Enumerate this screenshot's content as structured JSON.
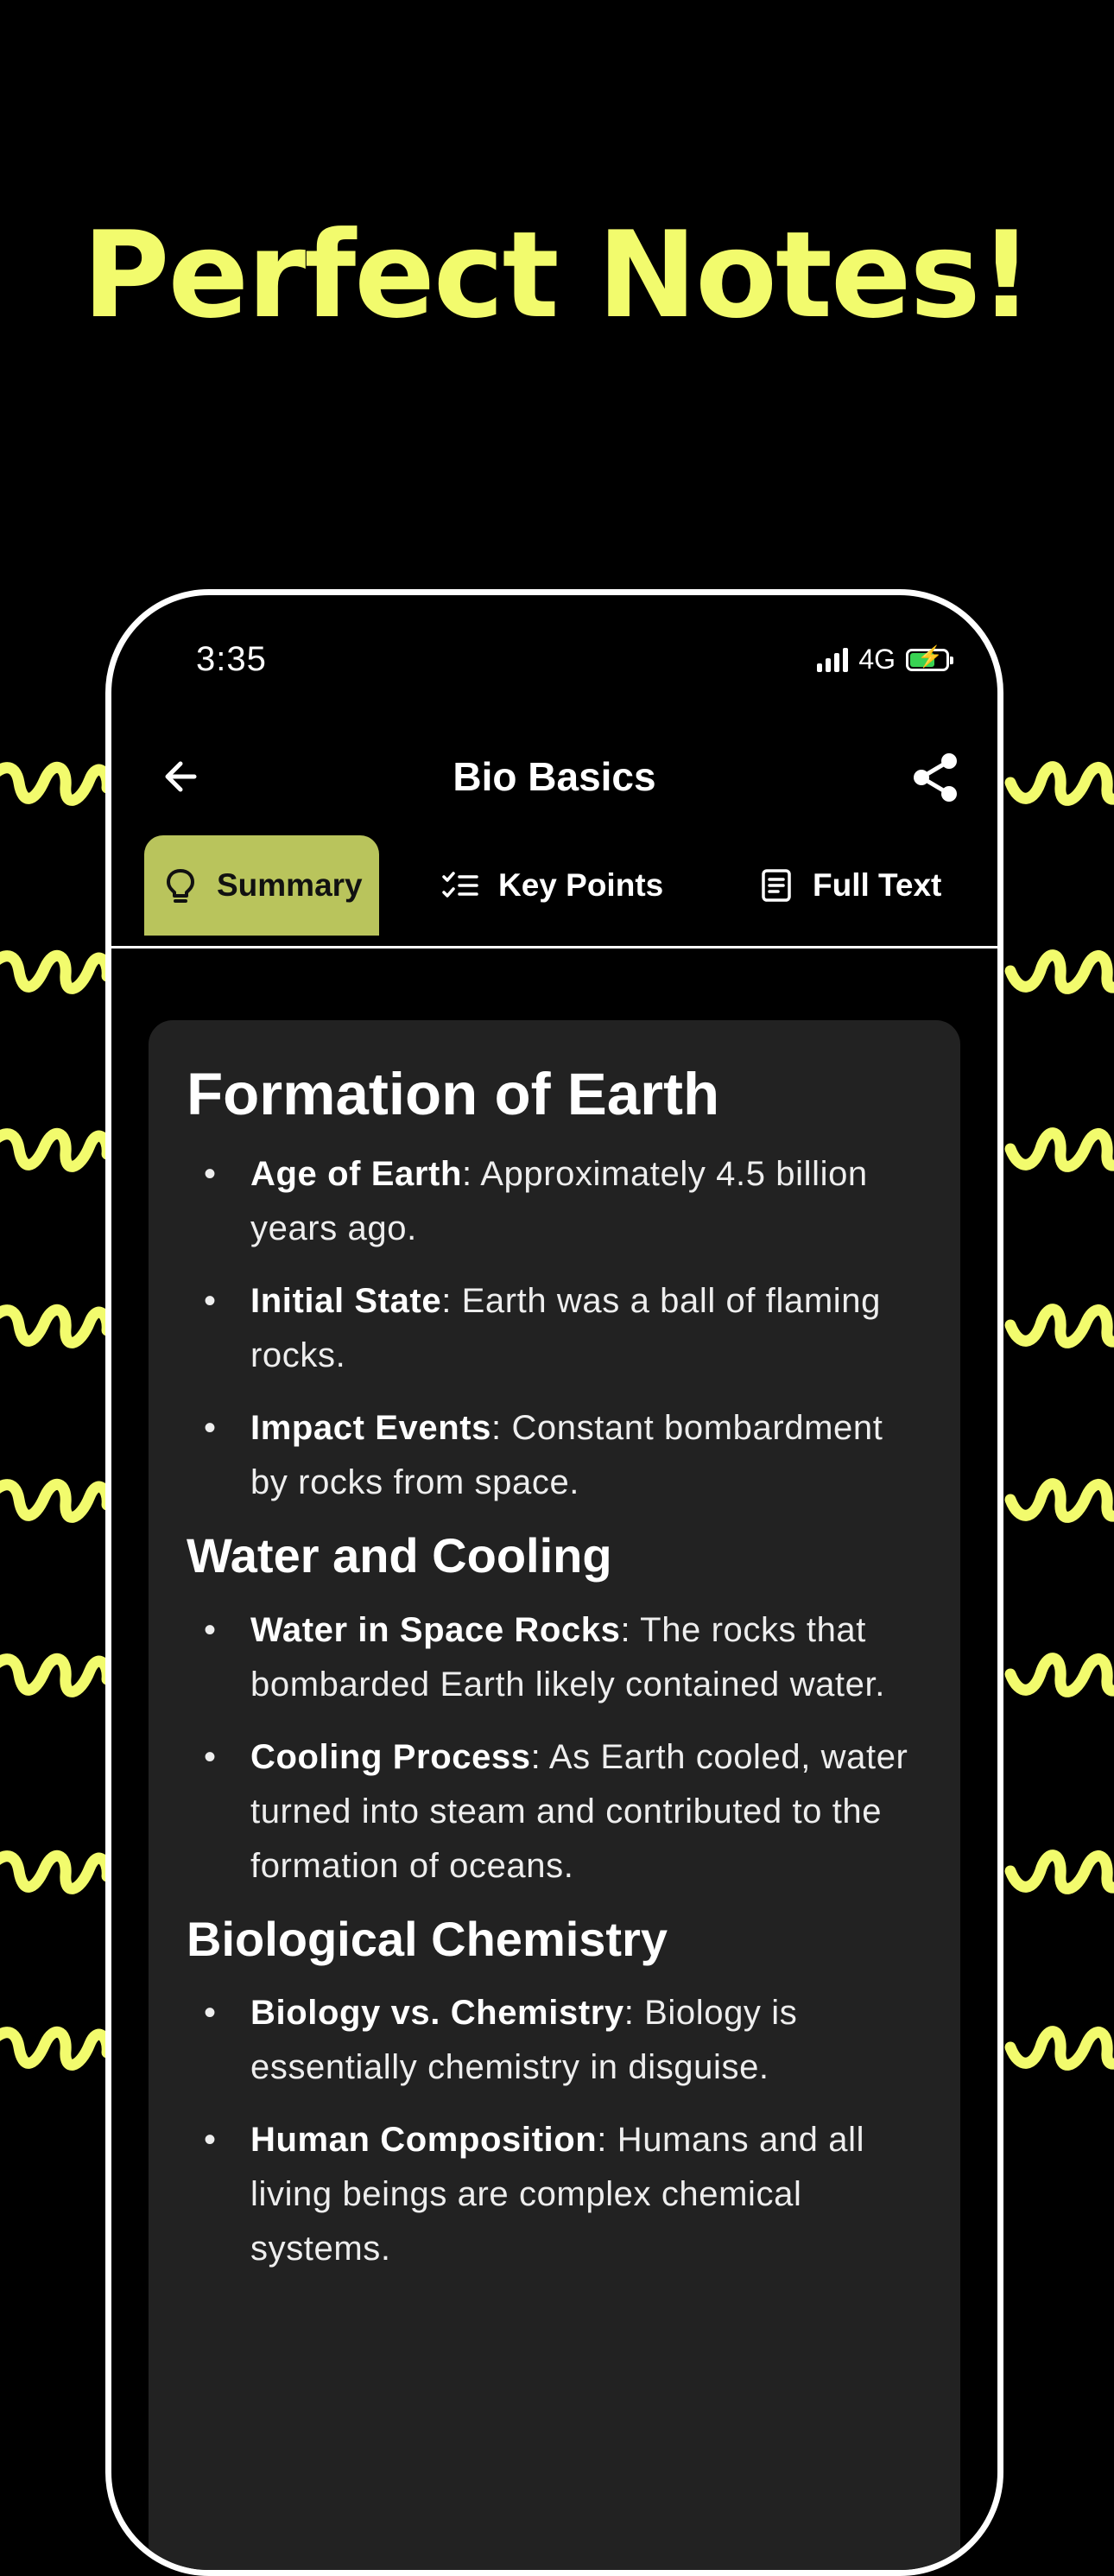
{
  "headline": "Perfect Notes!",
  "colors": {
    "accent": "#f2fb6d",
    "tab_active_bg": "#b9c45c",
    "card_bg": "#222222",
    "battery_fill": "#39d353"
  },
  "status_bar": {
    "time": "3:35",
    "network": "4G"
  },
  "nav": {
    "title": "Bio Basics",
    "back_icon": "arrow-left-icon",
    "share_icon": "share-icon"
  },
  "tabs": [
    {
      "label": "Summary",
      "icon": "lightbulb-icon",
      "active": true
    },
    {
      "label": "Key Points",
      "icon": "checklist-icon",
      "active": false
    },
    {
      "label": "Full Text",
      "icon": "document-icon",
      "active": false
    }
  ],
  "sections": [
    {
      "heading": "Formation of Earth",
      "items": [
        {
          "term": "Age of Earth",
          "text": ": Approximately 4.5 billion years ago."
        },
        {
          "term": "Initial State",
          "text": ": Earth was a ball of flaming rocks."
        },
        {
          "term": "Impact Events",
          "text": ": Constant bombardment by rocks from space."
        }
      ]
    },
    {
      "heading": "Water and Cooling",
      "items": [
        {
          "term": "Water in Space Rocks",
          "text": ": The rocks that bombarded Earth likely contained water."
        },
        {
          "term": "Cooling Process",
          "text": ": As Earth cooled, water turned into steam and contributed to the formation of oceans."
        }
      ]
    },
    {
      "heading": "Biological Chemistry",
      "items": [
        {
          "term": "Biology vs. Chemistry",
          "text": ": Biology is essentially chemistry in disguise."
        },
        {
          "term": "Human Composition",
          "text": ": Humans and all living beings are complex chemical systems."
        }
      ]
    }
  ]
}
